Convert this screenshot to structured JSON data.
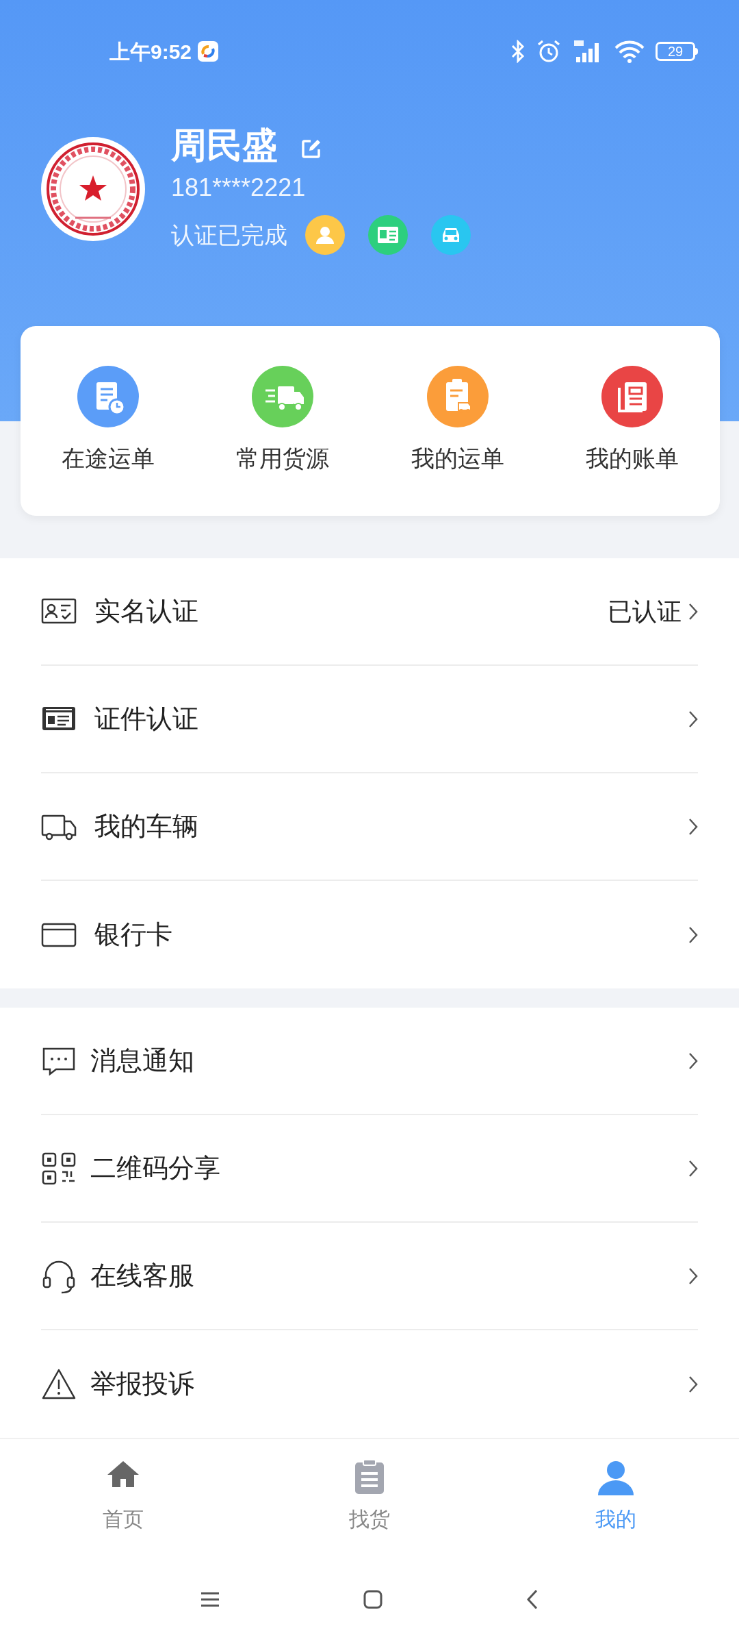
{
  "status_bar": {
    "time": "上午9:52",
    "battery": "29"
  },
  "profile": {
    "name": "周民盛",
    "phone": "181****2221",
    "verification": "认证已完成",
    "badges": [
      {
        "color": "#fdc748"
      },
      {
        "color": "#2dcf7e"
      },
      {
        "color": "#29c6f0"
      }
    ]
  },
  "quick_actions": [
    {
      "label": "在途运单",
      "color": "#5b9df8"
    },
    {
      "label": "常用货源",
      "color": "#67d05a"
    },
    {
      "label": "我的运单",
      "color": "#fb9d3a"
    },
    {
      "label": "我的账单",
      "color": "#e94545"
    }
  ],
  "menu_groups": [
    [
      {
        "label": "实名认证",
        "value": "已认证"
      },
      {
        "label": "证件认证"
      },
      {
        "label": "我的车辆"
      },
      {
        "label": "银行卡"
      }
    ],
    [
      {
        "label": "消息通知"
      },
      {
        "label": "二维码分享"
      },
      {
        "label": "在线客服"
      },
      {
        "label": "举报投诉"
      }
    ]
  ],
  "tab_bar": [
    {
      "label": "首页",
      "selected": false
    },
    {
      "label": "找货",
      "selected": false
    },
    {
      "label": "我的",
      "selected": true
    }
  ]
}
